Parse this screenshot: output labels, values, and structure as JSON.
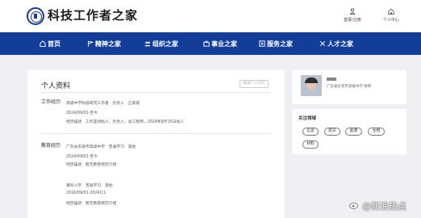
{
  "header": {
    "site_title": "科技工作者之家",
    "logo_icon": "emblem-logo",
    "actions": [
      {
        "label": "登录/注册",
        "icon": "user-icon"
      },
      {
        "label": "个人中心",
        "icon": "home-icon"
      }
    ]
  },
  "nav": {
    "items": [
      {
        "label": "首页",
        "icon": "home-icon"
      },
      {
        "label": "精神之家",
        "icon": "flag-icon"
      },
      {
        "label": "组织之家",
        "icon": "group-icon"
      },
      {
        "label": "事业之家",
        "icon": "briefcase-icon"
      },
      {
        "label": "服务之家",
        "icon": "service-icon"
      },
      {
        "label": "人才之家",
        "icon": "talent-icon"
      }
    ],
    "color": "#123e99"
  },
  "profile": {
    "section_title": "个人资料",
    "edit_button": "编辑个人资料",
    "work": {
      "label": "工作经历",
      "lines": [
        "高级中学科技研究工作者　负责人　正高级",
        "2024/09/01-至今",
        "经历描述　工作室创始人，负责人，总工程师，2024年9月15日加入"
      ]
    },
    "education": {
      "label": "教育经历",
      "entries": [
        {
          "lines": [
            "广东省东莞市高级中学　普通学习　其他",
            "2024/09/01-至今",
            "经历描述　暂无教育经历介绍"
          ]
        },
        {
          "lines": [
            "某科小学　普通学习　其他",
            "2016/09/01-2024/11",
            "经历描述　暂无教育经历介绍"
          ]
        }
      ]
    }
  },
  "sidebar": {
    "user_org": "广东省东莞市高级中学·教师",
    "interests_title": "关注领域",
    "tags": [
      "信息",
      "航天",
      "能源",
      "生物",
      "材料"
    ]
  },
  "watermark": {
    "text": "@新浪热点",
    "icon": "weibo-icon"
  }
}
